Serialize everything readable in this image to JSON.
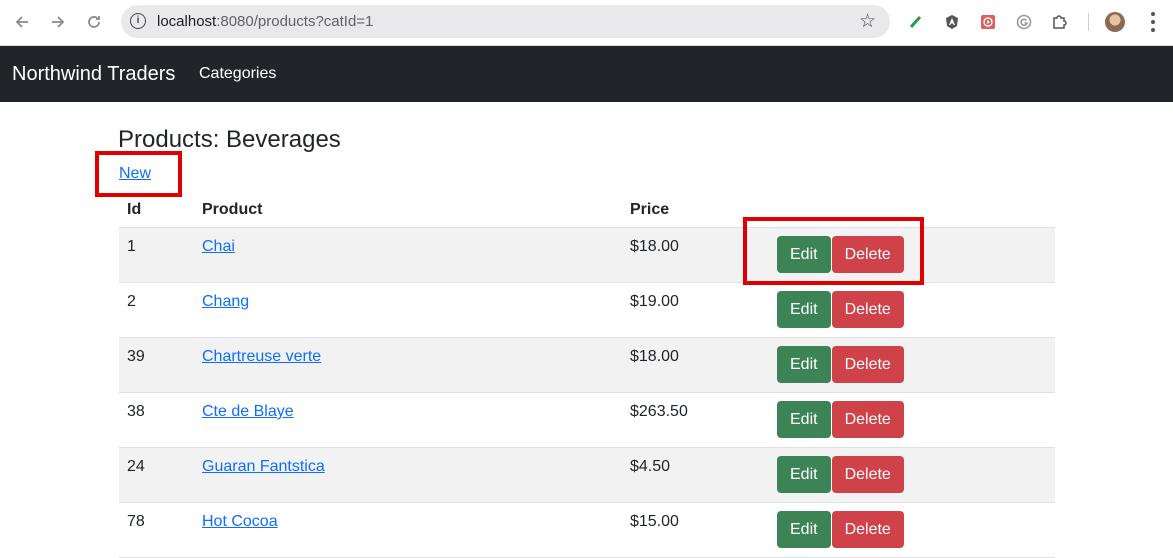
{
  "browser": {
    "url_host": "localhost",
    "url_rest": ":8080/products?catId=1"
  },
  "navbar": {
    "brand": "Northwind Traders",
    "links": [
      "Categories"
    ]
  },
  "page": {
    "title": "Products: Beverages",
    "new_link": "New"
  },
  "table": {
    "headers": [
      "Id",
      "Product",
      "Price",
      ""
    ],
    "edit_label": "Edit",
    "delete_label": "Delete",
    "rows": [
      {
        "id": "1",
        "product": "Chai",
        "price": "$18.00"
      },
      {
        "id": "2",
        "product": "Chang",
        "price": "$19.00"
      },
      {
        "id": "39",
        "product": "Chartreuse verte",
        "price": "$18.00"
      },
      {
        "id": "38",
        "product": "Cte de Blaye",
        "price": "$263.50"
      },
      {
        "id": "24",
        "product": "Guaran Fantstica",
        "price": "$4.50"
      },
      {
        "id": "78",
        "product": "Hot Cocoa",
        "price": "$15.00"
      }
    ]
  },
  "colors": {
    "navbar_bg": "#212529",
    "edit_btn": "#3c8456",
    "delete_btn": "#cf4249",
    "link": "#0d6efd",
    "highlight": "#e00000"
  }
}
